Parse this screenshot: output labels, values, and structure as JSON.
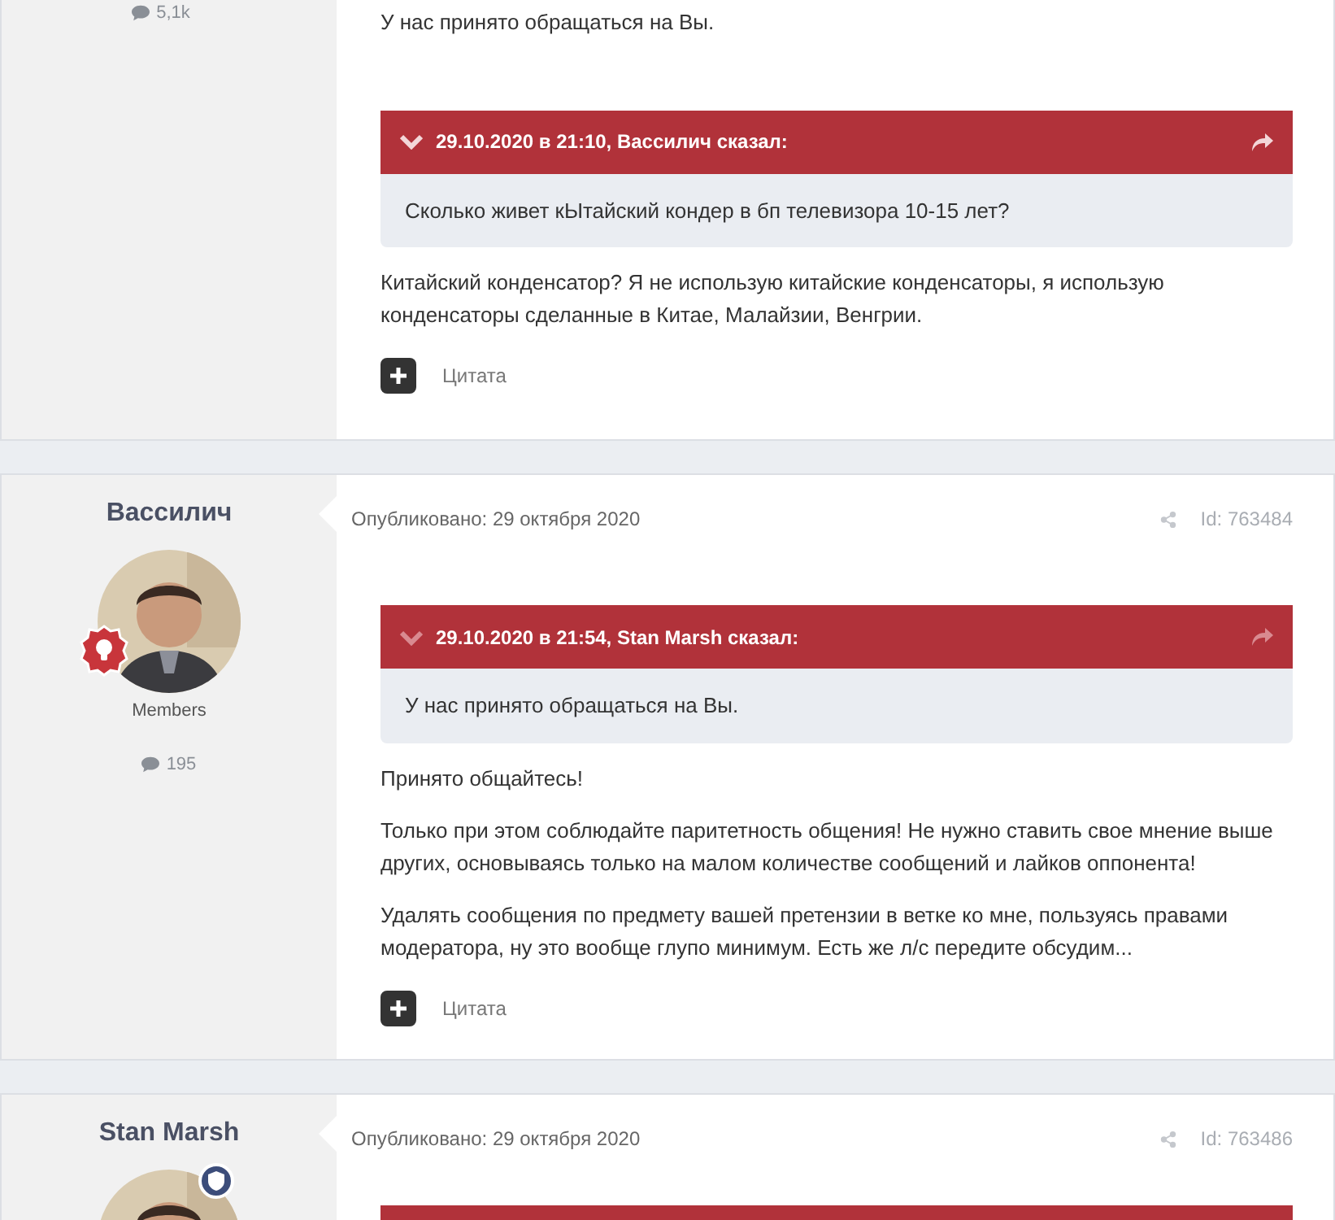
{
  "posts": [
    {
      "stats": "5,1k",
      "lead": "У нас принято обращаться на Вы.",
      "quote": {
        "kind": "full",
        "header": "29.10.2020 в 21:10, Вассилич сказал:",
        "text": "Сколько живет кЫтайский кондер в бп телевизора 10-15 лет?",
        "faded": false
      },
      "paragraphs": [
        "Китайский конденсатор? Я не использую китайские конденсаторы, я использую конденсаторы сделанные в Китае, Малайзии, Венгрии."
      ],
      "quote_button": "Цитата"
    },
    {
      "author": "Вассилич",
      "badge": {
        "kind": "bulb"
      },
      "group": "Members",
      "stats": "195",
      "date": "Опубликовано: 29 октября 2020",
      "post_id": "Id: 763484",
      "quote": {
        "kind": "full",
        "header": "29.10.2020 в 21:54, Stan Marsh сказал:",
        "text": "У нас принято обращаться на Вы.",
        "faded": true
      },
      "paragraphs": [
        "Принято общайтесь!",
        "Только при этом соблюдайте паритетность общения! Не нужно ставить свое мнение выше других, основываясь только на малом количестве сообщений и лайков оппонента!",
        "Удалять сообщения по предмету вашей претензии в ветке ко мне, пользуясь правами модератора, ну это вообще глупо минимум. Есть же л/с передите обсудим..."
      ],
      "quote_button": "Цитата"
    },
    {
      "author": "Stan Marsh",
      "badge": {
        "kind": "shield"
      },
      "date": "Опубликовано: 29 октября 2020",
      "post_id": "Id: 763486",
      "quote": {
        "kind": "bar"
      }
    }
  ]
}
